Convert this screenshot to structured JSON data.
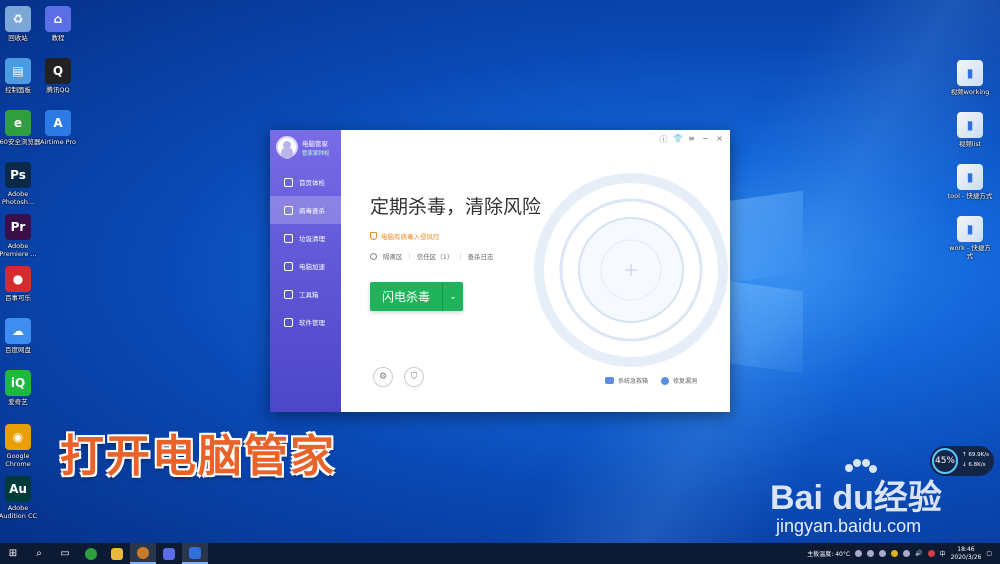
{
  "desktop": {
    "left_icons": [
      {
        "label": "回收站",
        "icon": "recycle-bin-icon",
        "color": "#7aa7d8",
        "glyph": "♻"
      },
      {
        "label": "教程",
        "icon": "tutorial-icon",
        "color": "#5c6ee6",
        "glyph": "⌂"
      },
      {
        "label": "控制面板",
        "icon": "control-panel-icon",
        "color": "#4c9ae0",
        "glyph": "▤"
      },
      {
        "label": "腾讯QQ",
        "icon": "qq-icon",
        "color": "#222222",
        "glyph": "Q"
      },
      {
        "label": "360安全浏览器",
        "icon": "browser-360-icon",
        "color": "#2f9e3f",
        "glyph": "e"
      },
      {
        "label": "Airtime Pro",
        "icon": "airtime-icon",
        "color": "#2c7be5",
        "glyph": "A"
      },
      {
        "label": "Adobe Photosh...",
        "icon": "photoshop-icon",
        "color": "#0b2a4a",
        "glyph": "Ps"
      },
      {
        "label": "Adobe Premiere ...",
        "icon": "premiere-icon",
        "color": "#3a0f4a",
        "glyph": "Pr"
      },
      {
        "label": "百事可乐",
        "icon": "pepsi-icon",
        "color": "#d52b2b",
        "glyph": "●"
      },
      {
        "label": "百度网盘",
        "icon": "baidu-netdisk-icon",
        "color": "#3d8ef0",
        "glyph": "☁"
      },
      {
        "label": "爱奇艺",
        "icon": "iqiyi-icon",
        "color": "#1eb83f",
        "glyph": "iQ"
      },
      {
        "label": "Google Chrome",
        "icon": "chrome-icon",
        "color": "#e8a000",
        "glyph": "◉"
      },
      {
        "label": "Adobe Audition CC",
        "icon": "audition-icon",
        "color": "#003a3a",
        "glyph": "Au"
      }
    ],
    "right_icons": [
      {
        "label": "视频working",
        "icon": "folder-icon"
      },
      {
        "label": "视频list",
        "icon": "folder-icon"
      },
      {
        "label": "tool - 快捷方式",
        "icon": "shortcut-icon"
      },
      {
        "label": "work - 快捷方式",
        "icon": "shortcut-icon"
      }
    ]
  },
  "app": {
    "profile_name": "电脑管家",
    "profile_sub": "管家家种权",
    "nav": [
      {
        "label": "首页体检",
        "icon": "monitor-icon"
      },
      {
        "label": "病毒查杀",
        "icon": "virus-scan-icon"
      },
      {
        "label": "垃圾清理",
        "icon": "cleanup-icon"
      },
      {
        "label": "电脑加速",
        "icon": "rocket-icon"
      },
      {
        "label": "工具箱",
        "icon": "toolbox-icon"
      },
      {
        "label": "软件管理",
        "icon": "software-icon"
      }
    ],
    "active_nav": 1,
    "heading": "定期杀毒，清除风险",
    "warning": "电脑有病毒入侵风险",
    "links": {
      "quarantine": "隔离区",
      "trust": "信任区（1）",
      "log": "查杀日志"
    },
    "scan_button": "闪电杀毒",
    "bottom_links": {
      "emergency": "系统急救箱",
      "repair": "修复漏洞"
    }
  },
  "caption": "打开电脑管家",
  "watermark": {
    "logo": "Bai du经验",
    "url": "jingyan.baidu.com"
  },
  "speed_widget": {
    "percent": "45%",
    "up": "↑ 69.9K/s",
    "down": "↓ 6.8K/s"
  },
  "taskbar": {
    "temp": "主板温度: 40°C",
    "time": "18:46",
    "date": "2020/3/26"
  },
  "colors": {
    "accent_green": "#1fb35c",
    "sidebar_purple": "#5f57d6",
    "warning_orange": "#f08a24",
    "caption_orange": "#e8622a"
  }
}
